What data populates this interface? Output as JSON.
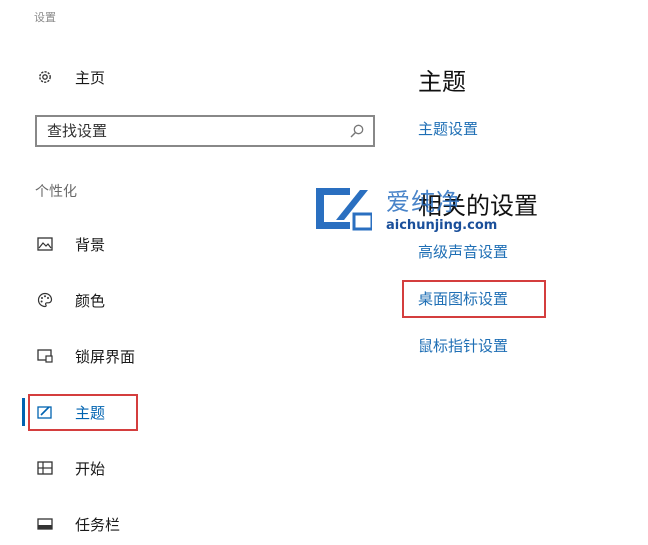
{
  "app": {
    "title": "设置"
  },
  "nav": {
    "home_label": "主页",
    "search_placeholder": "查找设置",
    "section_header": "个性化",
    "items": [
      {
        "label": "背景",
        "icon": "image-icon"
      },
      {
        "label": "颜色",
        "icon": "palette-icon"
      },
      {
        "label": "锁屏界面",
        "icon": "lockscreen-icon"
      },
      {
        "label": "主题",
        "icon": "theme-icon"
      },
      {
        "label": "开始",
        "icon": "start-icon"
      },
      {
        "label": "任务栏",
        "icon": "taskbar-icon"
      }
    ],
    "active_index": 3
  },
  "main": {
    "title": "主题",
    "theme_settings_link": "主题设置",
    "related_title": "相关的设置",
    "links": [
      "高级声音设置",
      "桌面图标设置",
      "鼠标指针设置"
    ]
  },
  "watermark": {
    "text": "爱纯净",
    "url": "aichunjing.com"
  },
  "colors": {
    "accent": "#0063b1",
    "link": "#1f6fb5",
    "highlight": "#d43e3e"
  }
}
